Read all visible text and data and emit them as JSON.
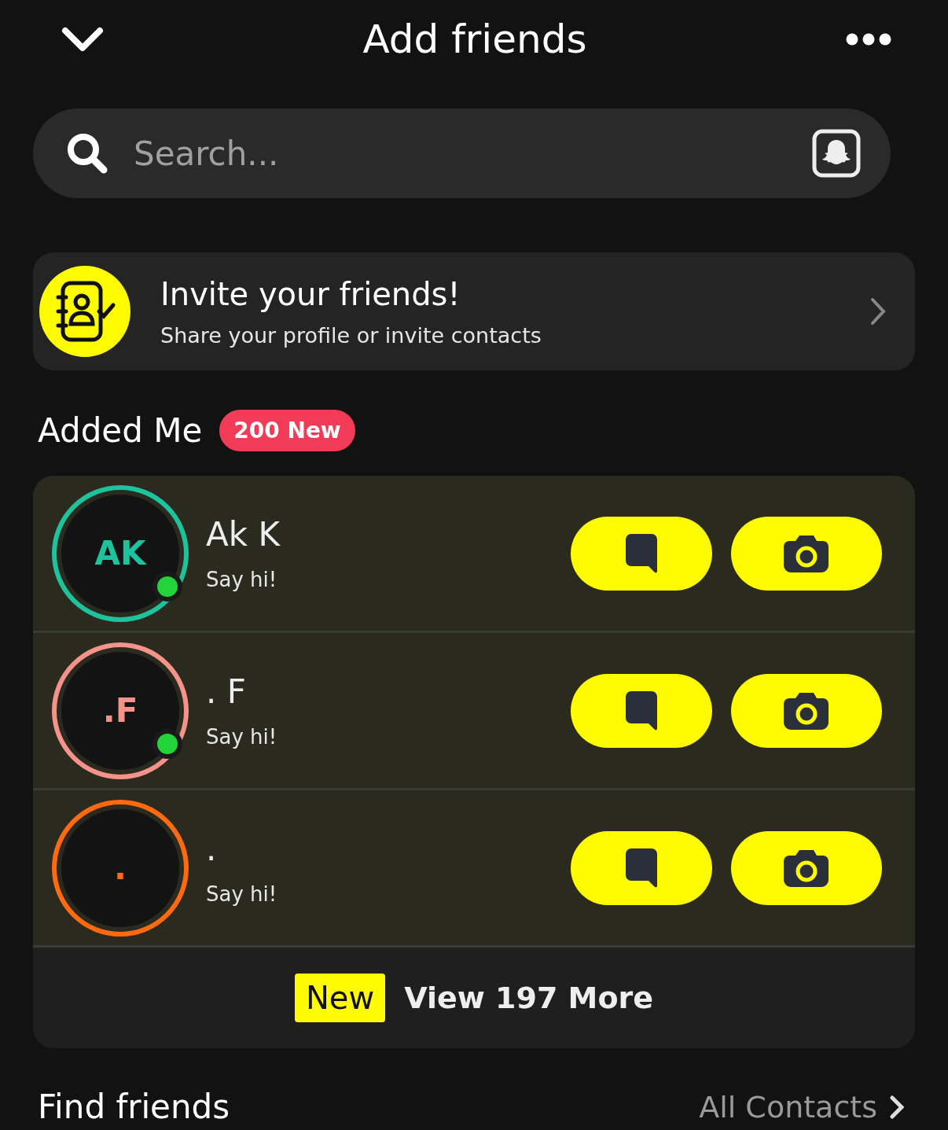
{
  "header": {
    "title": "Add friends"
  },
  "search": {
    "placeholder": "Search..."
  },
  "invite": {
    "title": "Invite your friends!",
    "subtitle": "Share your profile or invite contacts"
  },
  "added_me": {
    "title": "Added Me",
    "badge": "200 New",
    "friends": [
      {
        "initials": "AK",
        "name": "Ak K",
        "subtitle": "Say hi!",
        "color": "#1dc39c",
        "online": true
      },
      {
        "initials": ".F",
        "name": ". F",
        "subtitle": "Say hi!",
        "color": "#f5928a",
        "online": true
      },
      {
        "initials": ".",
        "name": ".",
        "subtitle": "Say hi!",
        "color": "#ff6a10",
        "online": false
      }
    ],
    "more_tag": "New",
    "more_label": "View 197 More"
  },
  "find_friends": {
    "title": "Find friends",
    "link": "All Contacts"
  }
}
